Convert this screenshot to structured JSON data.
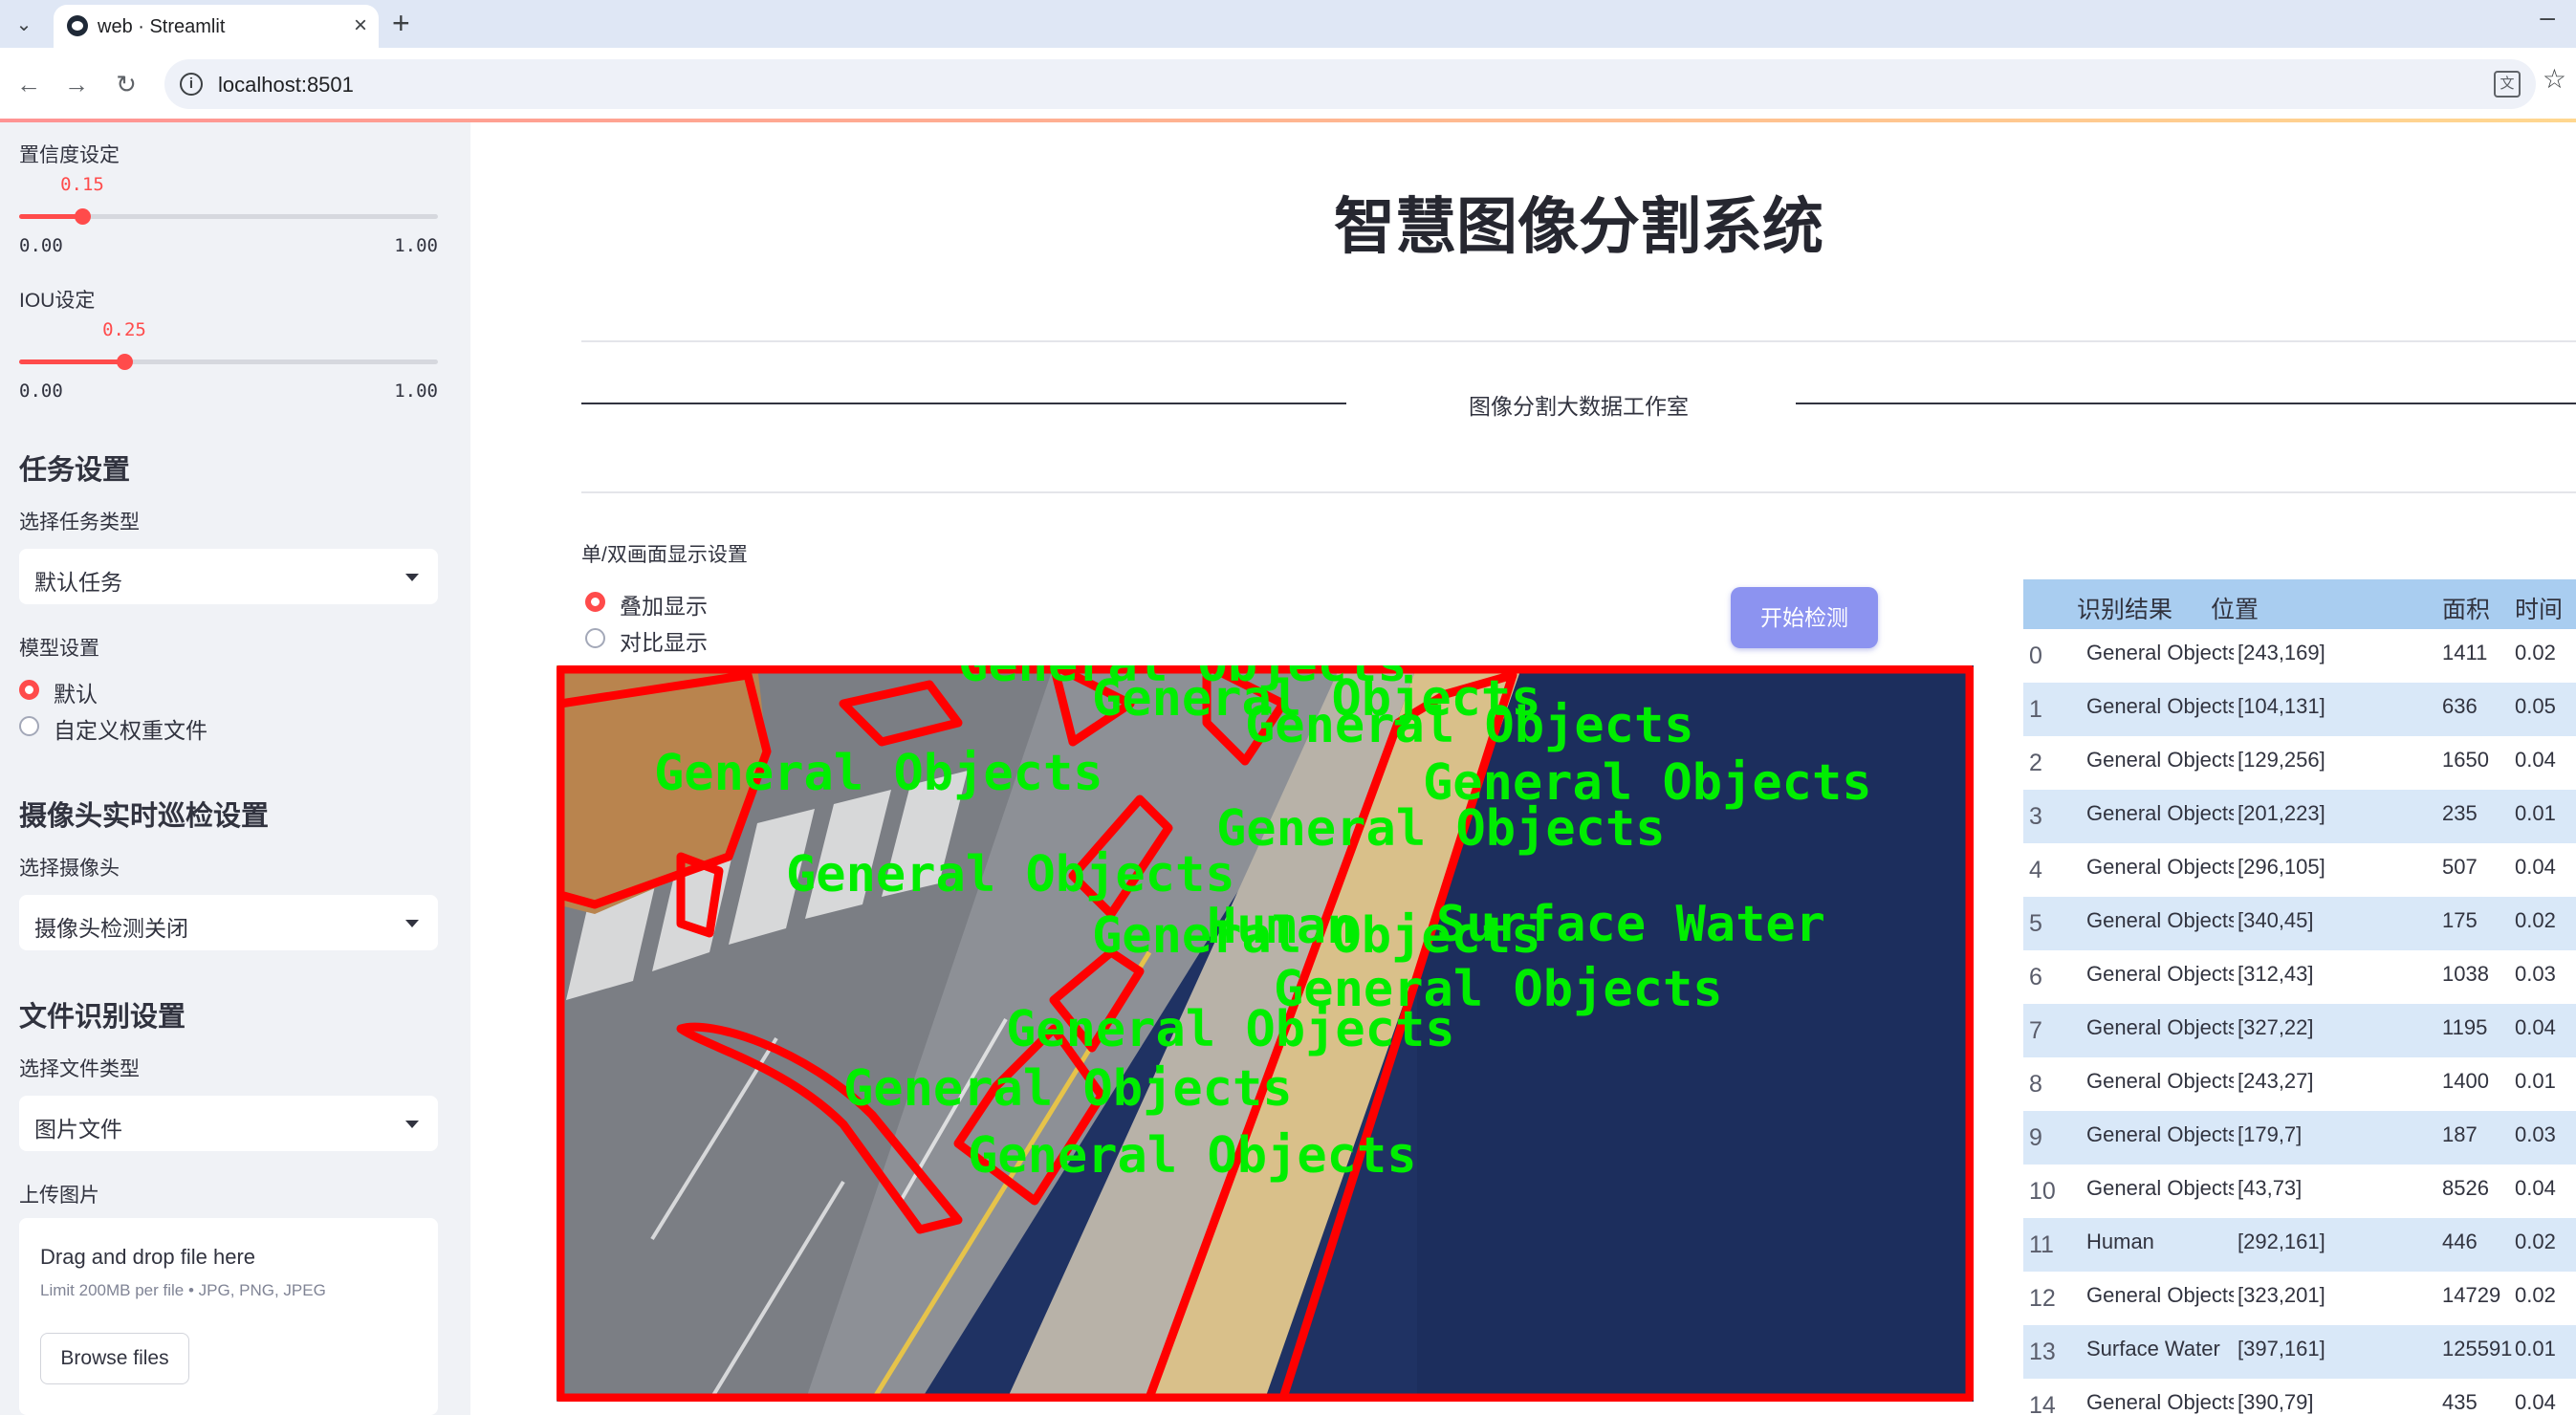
{
  "browser": {
    "tab_title": "web · Streamlit",
    "url": "localhost:8501"
  },
  "sidebar": {
    "confidence": {
      "label": "置信度设定",
      "value": "0.15",
      "min": "0.00",
      "max": "1.00",
      "fraction": 0.15
    },
    "iou": {
      "label": "IOU设定",
      "value": "0.25",
      "min": "0.00",
      "max": "1.00",
      "fraction": 0.25
    },
    "task_heading": "任务设置",
    "task_type_label": "选择任务类型",
    "task_type_value": "默认任务",
    "model_label": "模型设置",
    "model_options": [
      "默认",
      "自定义权重文件"
    ],
    "model_selected": "默认",
    "camera_heading": "摄像头实时巡检设置",
    "camera_label": "选择摄像头",
    "camera_value": "摄像头检测关闭",
    "file_heading": "文件识别设置",
    "file_type_label": "选择文件类型",
    "file_type_value": "图片文件",
    "upload_label": "上传图片",
    "uploader": {
      "title": "Drag and drop file here",
      "subtitle": "Limit 200MB per file • JPG, PNG, JPEG",
      "button": "Browse files"
    }
  },
  "main": {
    "title": "智慧图像分割系统",
    "studio_text": "图像分割大数据工作室",
    "display_label": "单/双画面显示设置",
    "display_options": [
      "叠加显示",
      "对比显示"
    ],
    "display_selected": "叠加显示",
    "start_button": "开始检测"
  },
  "image_labels": [
    "General Objects",
    "General Objects",
    "General Objects",
    "General Objects",
    "General Objects",
    "General Objects",
    "General Objects",
    "General Objects",
    "General Objects",
    "General Objects",
    "General Objects",
    "Human",
    "Surface Water",
    "General Objects"
  ],
  "colors": {
    "accent": "#ff4b4b",
    "button": "#8c93f0",
    "table_header": "#a9cdf0",
    "mask_outline": "#ff0000",
    "label_text": "#00ff00",
    "water": "#1c2f5e"
  },
  "table": {
    "columns": [
      "识别结果",
      "位置",
      "面积",
      "时间"
    ],
    "rows": [
      {
        "idx": "0",
        "cls": "General Objects",
        "pos": "[243,169]",
        "area": "1411",
        "time": "0.02"
      },
      {
        "idx": "1",
        "cls": "General Objects",
        "pos": "[104,131]",
        "area": "636",
        "time": "0.05"
      },
      {
        "idx": "2",
        "cls": "General Objects",
        "pos": "[129,256]",
        "area": "1650",
        "time": "0.04"
      },
      {
        "idx": "3",
        "cls": "General Objects",
        "pos": "[201,223]",
        "area": "235",
        "time": "0.01"
      },
      {
        "idx": "4",
        "cls": "General Objects",
        "pos": "[296,105]",
        "area": "507",
        "time": "0.04"
      },
      {
        "idx": "5",
        "cls": "General Objects",
        "pos": "[340,45]",
        "area": "175",
        "time": "0.02"
      },
      {
        "idx": "6",
        "cls": "General Objects",
        "pos": "[312,43]",
        "area": "1038",
        "time": "0.03"
      },
      {
        "idx": "7",
        "cls": "General Objects",
        "pos": "[327,22]",
        "area": "1195",
        "time": "0.04"
      },
      {
        "idx": "8",
        "cls": "General Objects",
        "pos": "[243,27]",
        "area": "1400",
        "time": "0.01"
      },
      {
        "idx": "9",
        "cls": "General Objects",
        "pos": "[179,7]",
        "area": "187",
        "time": "0.03"
      },
      {
        "idx": "10",
        "cls": "General Objects",
        "pos": "[43,73]",
        "area": "8526",
        "time": "0.04"
      },
      {
        "idx": "11",
        "cls": "Human",
        "pos": "[292,161]",
        "area": "446",
        "time": "0.02"
      },
      {
        "idx": "12",
        "cls": "General Objects",
        "pos": "[323,201]",
        "area": "14729",
        "time": "0.02"
      },
      {
        "idx": "13",
        "cls": "Surface Water",
        "pos": "[397,161]",
        "area": "125591",
        "time": "0.01"
      },
      {
        "idx": "14",
        "cls": "General Objects",
        "pos": "[390,79]",
        "area": "435",
        "time": "0.04"
      }
    ]
  }
}
